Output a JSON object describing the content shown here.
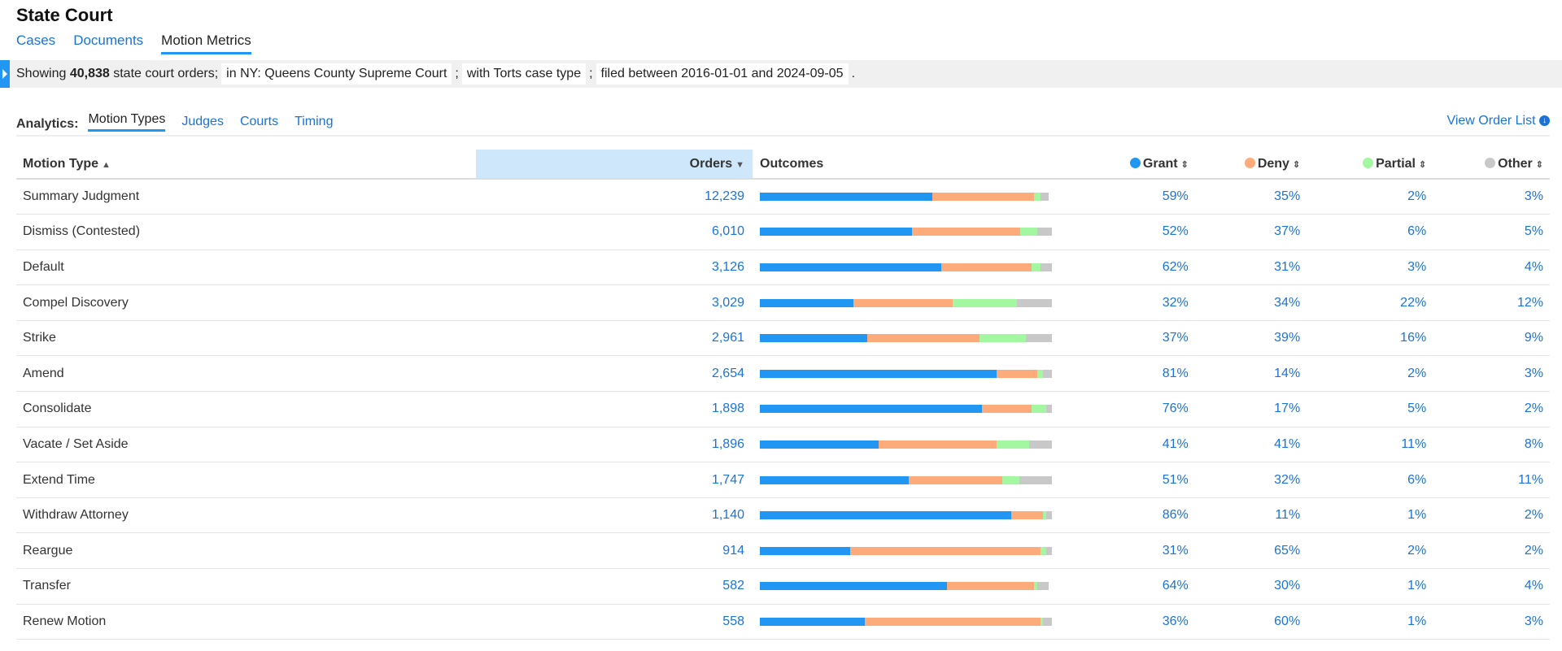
{
  "title": "State Court",
  "nav_tabs": [
    {
      "label": "Cases"
    },
    {
      "label": "Documents"
    },
    {
      "label": "Motion Metrics",
      "active": true
    }
  ],
  "filter": {
    "prefix": "Showing ",
    "count": "40,838",
    "suffix": " state court orders;",
    "chips": [
      "in NY: Queens County Supreme Court",
      "with Torts case type",
      "filed between 2016-01-01 and 2024-09-05"
    ],
    "seps": [
      ";",
      ";",
      "."
    ]
  },
  "analytics": {
    "label": "Analytics:",
    "tabs": [
      {
        "label": "Motion Types",
        "active": true
      },
      {
        "label": "Judges"
      },
      {
        "label": "Courts"
      },
      {
        "label": "Timing"
      }
    ]
  },
  "view_order_list": "View Order List",
  "colors": {
    "grant": "#2196f3",
    "deny": "#fdab7b",
    "partial": "#a3f7a0",
    "other": "#c8c8c8"
  },
  "columns": {
    "motion_type": "Motion Type",
    "orders": "Orders",
    "outcomes": "Outcomes",
    "grant": "Grant",
    "deny": "Deny",
    "partial": "Partial",
    "other": "Other"
  },
  "rows": [
    {
      "type": "Summary Judgment",
      "orders": "12,239",
      "grant": "59%",
      "deny": "35%",
      "partial": "2%",
      "other": "3%"
    },
    {
      "type": "Dismiss (Contested)",
      "orders": "6,010",
      "grant": "52%",
      "deny": "37%",
      "partial": "6%",
      "other": "5%"
    },
    {
      "type": "Default",
      "orders": "3,126",
      "grant": "62%",
      "deny": "31%",
      "partial": "3%",
      "other": "4%"
    },
    {
      "type": "Compel Discovery",
      "orders": "3,029",
      "grant": "32%",
      "deny": "34%",
      "partial": "22%",
      "other": "12%"
    },
    {
      "type": "Strike",
      "orders": "2,961",
      "grant": "37%",
      "deny": "39%",
      "partial": "16%",
      "other": "9%"
    },
    {
      "type": "Amend",
      "orders": "2,654",
      "grant": "81%",
      "deny": "14%",
      "partial": "2%",
      "other": "3%"
    },
    {
      "type": "Consolidate",
      "orders": "1,898",
      "grant": "76%",
      "deny": "17%",
      "partial": "5%",
      "other": "2%"
    },
    {
      "type": "Vacate / Set Aside",
      "orders": "1,896",
      "grant": "41%",
      "deny": "41%",
      "partial": "11%",
      "other": "8%"
    },
    {
      "type": "Extend Time",
      "orders": "1,747",
      "grant": "51%",
      "deny": "32%",
      "partial": "6%",
      "other": "11%"
    },
    {
      "type": "Withdraw Attorney",
      "orders": "1,140",
      "grant": "86%",
      "deny": "11%",
      "partial": "1%",
      "other": "2%"
    },
    {
      "type": "Reargue",
      "orders": "914",
      "grant": "31%",
      "deny": "65%",
      "partial": "2%",
      "other": "2%"
    },
    {
      "type": "Transfer",
      "orders": "582",
      "grant": "64%",
      "deny": "30%",
      "partial": "1%",
      "other": "4%"
    },
    {
      "type": "Renew Motion",
      "orders": "558",
      "grant": "36%",
      "deny": "60%",
      "partial": "1%",
      "other": "3%"
    }
  ]
}
